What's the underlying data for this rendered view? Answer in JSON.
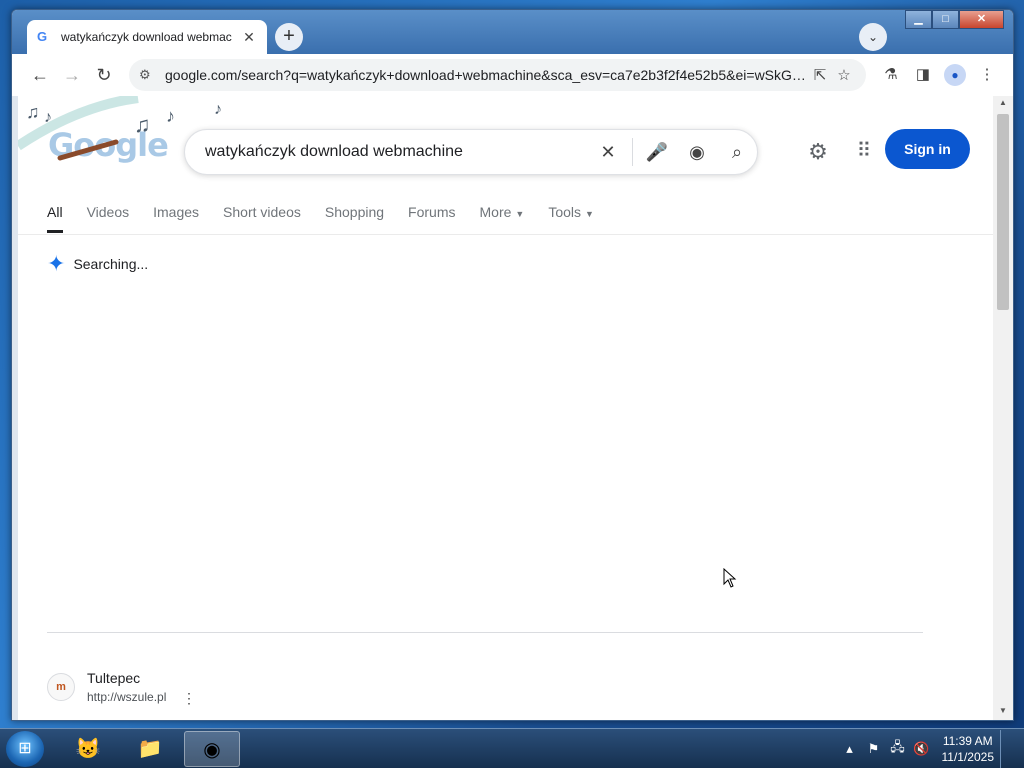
{
  "browser": {
    "tab_title": "watykańczyk download webmac",
    "url": "google.com/search?q=watykańczyk+download+webmachine&sca_esv=ca7e2b3f2f4e52b5&ei=wSkGad..."
  },
  "search": {
    "query": "watykańczyk download webmachine",
    "sign_in": "Sign in"
  },
  "tabs": [
    "All",
    "Videos",
    "Images",
    "Short videos",
    "Shopping",
    "Forums",
    "More",
    "Tools"
  ],
  "status": {
    "searching": "Searching..."
  },
  "result": {
    "title": "Tultepec",
    "url": "http://wszule.pl",
    "favicon_text": "m"
  },
  "taskbar": {
    "time": "11:39 AM",
    "date": "11/1/2025"
  },
  "colors": {
    "signin_bg": "#0b57d0",
    "accent": "#1a73e8"
  }
}
